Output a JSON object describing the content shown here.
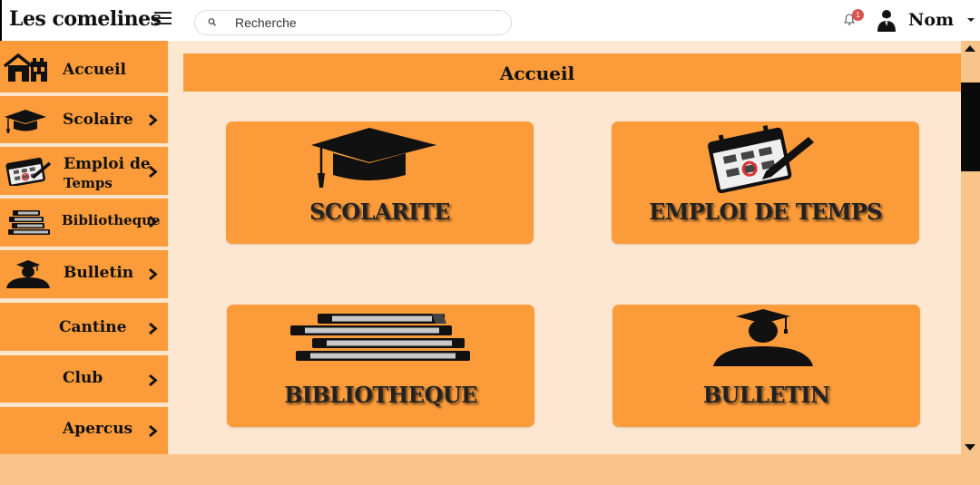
{
  "app": {
    "title": "Les comelines"
  },
  "search": {
    "placeholder": "Recherche"
  },
  "notifications": {
    "count": "1"
  },
  "user": {
    "name": "Nom"
  },
  "sidebar": {
    "items": [
      {
        "label": "Accueil",
        "icon": "house-icon",
        "has_chevron": false
      },
      {
        "label": "Scolaire",
        "icon": "graduation-cap-icon",
        "has_chevron": true
      },
      {
        "label": "Emploi de",
        "label2": "Temps",
        "icon": "calendar-icon",
        "has_chevron": true
      },
      {
        "label": "Bibliotheque",
        "icon": "books-icon",
        "has_chevron": true
      },
      {
        "label": "Bulletin",
        "icon": "graduate-icon",
        "has_chevron": true
      },
      {
        "label": "Cantine",
        "icon": "",
        "has_chevron": true
      },
      {
        "label": "Club",
        "icon": "",
        "has_chevron": true
      },
      {
        "label": "Apercus",
        "icon": "",
        "has_chevron": true
      }
    ]
  },
  "main": {
    "title": "Accueil",
    "cards": [
      {
        "label": "SCOLARITE",
        "icon": "graduation-cap-icon"
      },
      {
        "label": "EMPLOI DE TEMPS",
        "icon": "calendar-icon"
      },
      {
        "label": "BIBLIOTHEQUE",
        "icon": "books-icon"
      },
      {
        "label": "BULLETIN",
        "icon": "graduate-icon"
      }
    ]
  },
  "colors": {
    "accent": "#fb9b3a",
    "content_bg": "#fde7d1",
    "outer_bg": "#f8c48a",
    "badge": "#d9534f"
  }
}
